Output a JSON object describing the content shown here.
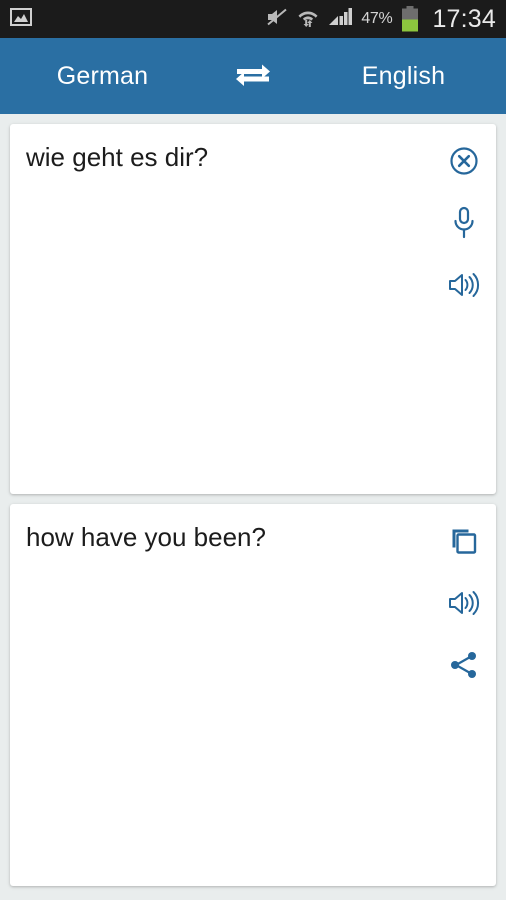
{
  "status_bar": {
    "left_icons": [
      {
        "name": "image-notification-icon",
        "glyph": "photo"
      }
    ],
    "right_icons": [
      {
        "name": "volume-muted-icon",
        "glyph": "speaker-mute"
      },
      {
        "name": "wifi-data-transfer-icon",
        "glyph": "wifi-arrows"
      },
      {
        "name": "cellular-signal-icon",
        "glyph": "signal-bars"
      }
    ],
    "battery_percent": "47%",
    "battery_level": 47,
    "battery_color": "#8cc63e",
    "clock": "17:34",
    "background": "#1b1b1b"
  },
  "header": {
    "source_language": "German",
    "target_language": "English",
    "swap_icon": "swap-horizontal-icon",
    "background": "#2a6fa3",
    "text_color": "#ffffff"
  },
  "accent_color": "#26679b",
  "cards": [
    {
      "id": "source",
      "name": "source-text-card",
      "text": "wie geht es dir?",
      "actions": [
        {
          "name": "clear-text-button",
          "icon": "close-circle-icon",
          "label": "Clear"
        },
        {
          "name": "voice-input-button",
          "icon": "microphone-icon",
          "label": "Voice input"
        },
        {
          "name": "speak-source-button",
          "icon": "speaker-icon",
          "label": "Listen"
        }
      ]
    },
    {
      "id": "target",
      "name": "translated-text-card",
      "text": "how have you been?",
      "actions": [
        {
          "name": "copy-translation-button",
          "icon": "copy-icon",
          "label": "Copy"
        },
        {
          "name": "speak-translation-button",
          "icon": "speaker-icon",
          "label": "Listen"
        },
        {
          "name": "share-translation-button",
          "icon": "share-icon",
          "label": "Share"
        }
      ]
    }
  ]
}
